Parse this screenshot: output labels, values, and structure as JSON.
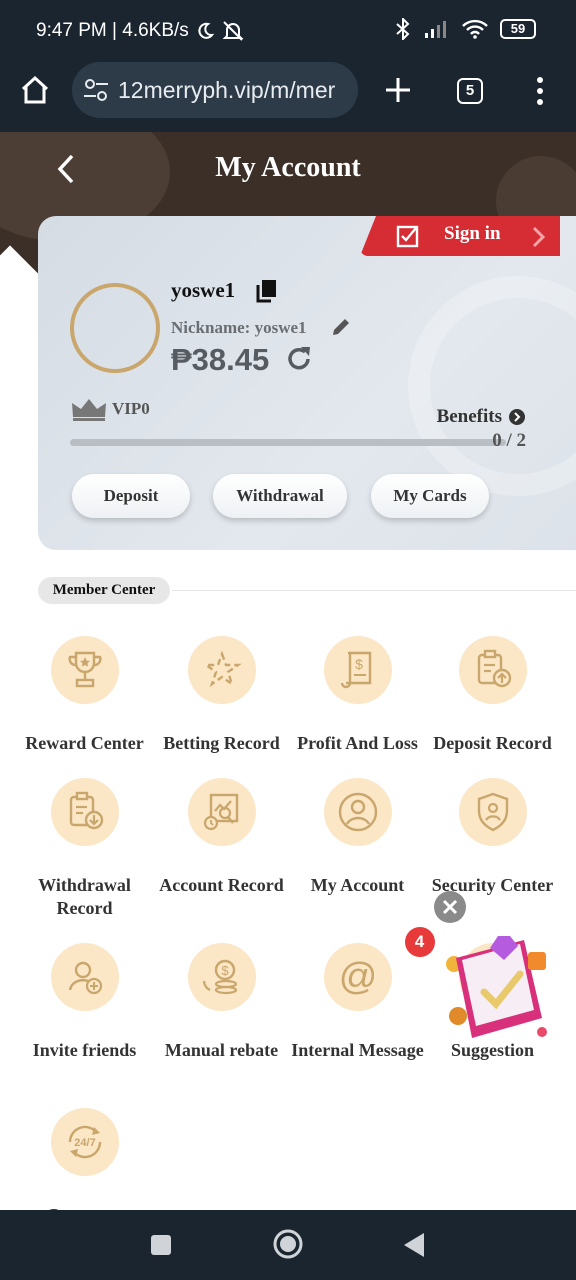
{
  "status_bar": {
    "time_speed": "9:47 PM | 4.6KB/s",
    "battery": "59"
  },
  "browser": {
    "url": "12merryph.vip/m/mer",
    "tab_count": "5"
  },
  "header": {
    "title": "My Account"
  },
  "account_card": {
    "sign_in_label": "Sign in",
    "username": "yoswe1",
    "nickname": "Nickname: yoswe1",
    "balance": "₱38.45",
    "vip_label": "VIP0",
    "benefits_label": "Benefits",
    "progress_text": "0 / 2",
    "progress_value": 0,
    "buttons": {
      "deposit": "Deposit",
      "withdrawal": "Withdrawal",
      "my_cards": "My Cards"
    }
  },
  "member_center": {
    "section_title": "Member Center",
    "items": [
      {
        "label": "Reward Center",
        "icon": "trophy-icon"
      },
      {
        "label": "Betting Record",
        "icon": "betting-icon"
      },
      {
        "label": "Profit And Loss",
        "icon": "receipt-icon"
      },
      {
        "label": "Deposit Record",
        "icon": "deposit-record-icon"
      },
      {
        "label": "Withdrawal Record",
        "icon": "withdrawal-record-icon"
      },
      {
        "label": "Account Record",
        "icon": "account-record-icon"
      },
      {
        "label": "My Account",
        "icon": "user-icon"
      },
      {
        "label": "Security Center",
        "icon": "shield-icon"
      },
      {
        "label": "Invite friends",
        "icon": "invite-icon"
      },
      {
        "label": "Manual rebate",
        "icon": "rebate-icon"
      },
      {
        "label": "Internal Message",
        "icon": "at-icon",
        "badge": "4"
      },
      {
        "label": "Suggestion",
        "icon": "suggestion-icon"
      },
      {
        "label": "Customer",
        "icon": "support-24-7-icon"
      }
    ]
  },
  "colors": {
    "header_bg": "#3b2f28",
    "icon_circle": "#fbe6c6",
    "icon_stroke": "#c9a66b",
    "sign_in_bg": "#d62c34",
    "badge": "#e83a3a"
  }
}
